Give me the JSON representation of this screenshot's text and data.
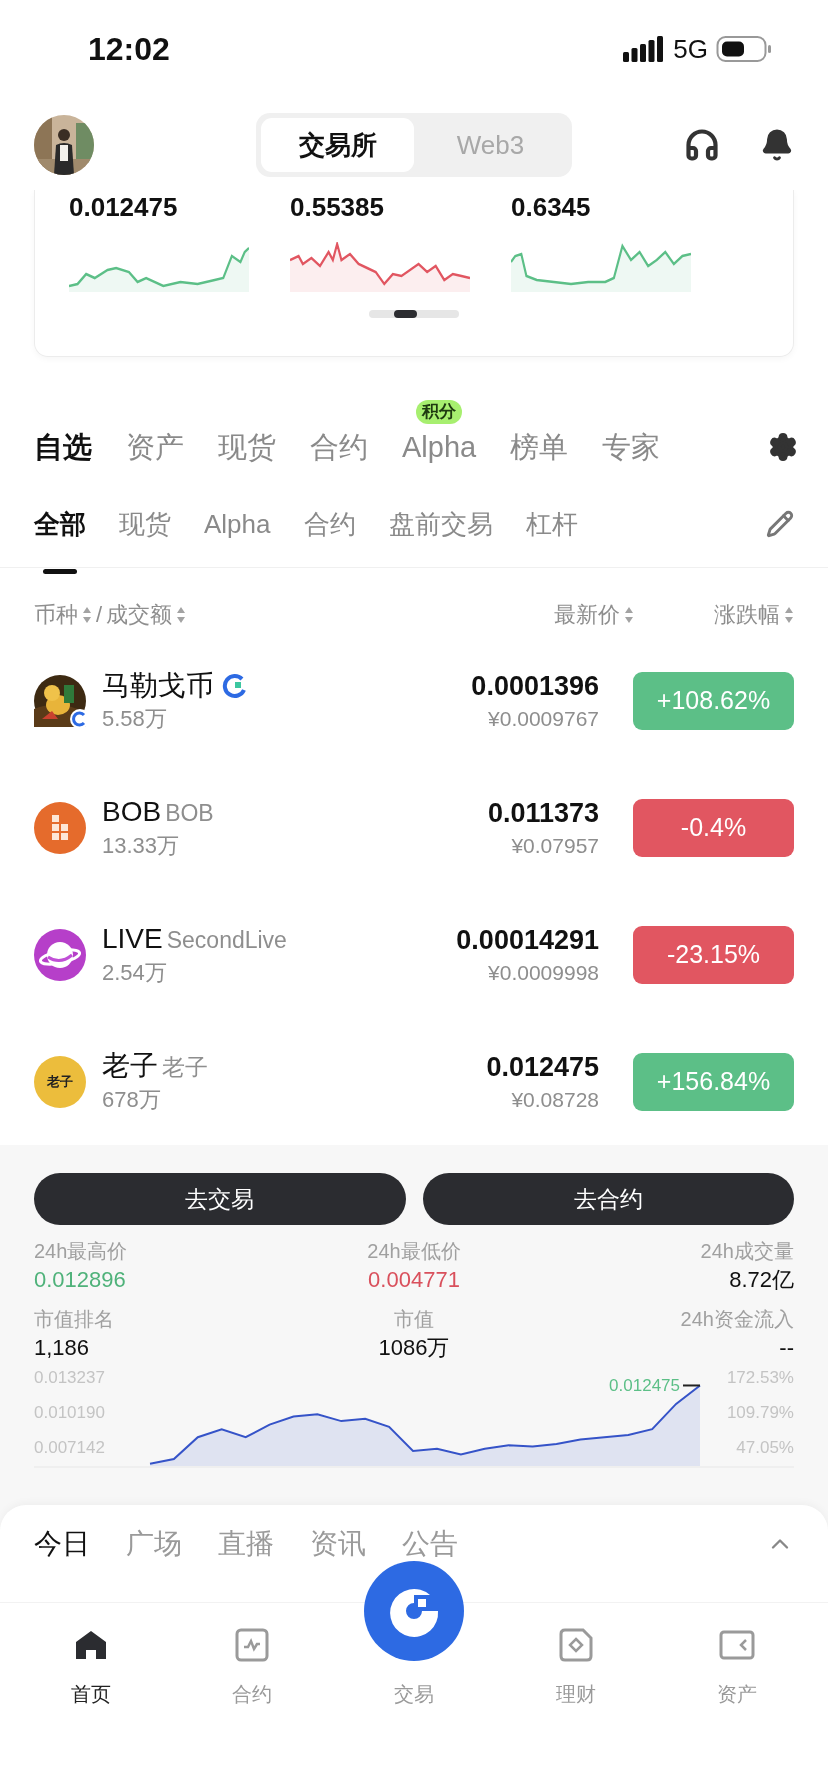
{
  "status_bar": {
    "time": "12:02",
    "network": "5G"
  },
  "header": {
    "segments": [
      {
        "label": "交易所",
        "selected": true
      },
      {
        "label": "Web3",
        "selected": false
      }
    ]
  },
  "tickers": [
    {
      "price": "0.012475",
      "color": "#5cbf87"
    },
    {
      "price": "0.55385",
      "color": "#e15661"
    },
    {
      "price": "0.6345",
      "color": "#5cbf87"
    }
  ],
  "market_tabs": [
    {
      "label": "自选",
      "selected": true
    },
    {
      "label": "资产",
      "selected": false
    },
    {
      "label": "现货",
      "selected": false
    },
    {
      "label": "合约",
      "selected": false
    },
    {
      "label": "Alpha",
      "selected": false,
      "badge": "积分"
    },
    {
      "label": "榜单",
      "selected": false
    },
    {
      "label": "专家",
      "selected": false
    }
  ],
  "filter_tabs": [
    {
      "label": "全部",
      "selected": true
    },
    {
      "label": "现货",
      "selected": false
    },
    {
      "label": "Alpha",
      "selected": false
    },
    {
      "label": "合约",
      "selected": false
    },
    {
      "label": "盘前交易",
      "selected": false
    },
    {
      "label": "杠杆",
      "selected": false
    }
  ],
  "column_headers": {
    "left": [
      {
        "kind": "sort",
        "label": "币种"
      },
      {
        "kind": "text",
        "label": "/"
      },
      {
        "kind": "sort",
        "label": "成交额"
      }
    ],
    "right": [
      {
        "kind": "sort",
        "label": "最新价"
      },
      {
        "kind": "sort",
        "label": "涨跌幅"
      }
    ]
  },
  "coins": [
    {
      "kind": "picture",
      "name": "马勒戈币",
      "verified": true,
      "volume": "5.58万",
      "price": "0.0001396",
      "price_cny": "¥0.0009767",
      "change": "+108.62%",
      "color": "#5cbf87"
    },
    {
      "kind": "grid",
      "name": "BOB",
      "full_name": "BOB",
      "verified": false,
      "volume": "13.33万",
      "price": "0.011373",
      "price_cny": "¥0.07957",
      "change": "-0.4%",
      "color": "#e15661"
    },
    {
      "kind": "planet",
      "name": "LIVE",
      "full_name": "SecondLive",
      "verified": false,
      "volume": "2.54万",
      "price": "0.00014291",
      "price_cny": "¥0.0009998",
      "change": "-23.15%",
      "color": "#e15661"
    },
    {
      "kind": "text",
      "logo_text": "老子",
      "name": "老子",
      "full_name": "老子",
      "verified": false,
      "volume": "678万",
      "price": "0.012475",
      "price_cny": "¥0.08728",
      "change": "+156.84%",
      "color": "#5cbf87"
    }
  ],
  "detail": {
    "actions": [
      {
        "label": "去交易"
      },
      {
        "label": "去合约"
      }
    ],
    "stats": [
      {
        "label": "24h最高价",
        "value": "0.012896",
        "color": "#4fb27a"
      },
      {
        "label": "24h最低价",
        "value": "0.004771",
        "color": "#d9505c"
      },
      {
        "label": "24h成交量",
        "value": "8.72亿",
        "color": "#111111"
      },
      {
        "label": "市值排名",
        "value": "1,186",
        "color": "#111111"
      },
      {
        "label": "市值",
        "value": "1086万",
        "color": "#111111"
      },
      {
        "label": "24h资金流入",
        "value": "--",
        "color": "#111111"
      }
    ],
    "chart": {
      "right_ticks": [
        "172.53%",
        "109.79%",
        "47.05%"
      ],
      "chart_data": {
        "type": "area",
        "ylim": [
          0.0055,
          0.013237
        ],
        "yticks": [
          {
            "value": 0.013237,
            "label": "0.013237"
          },
          {
            "value": 0.01019,
            "label": "0.010190"
          },
          {
            "value": 0.007142,
            "label": "0.007142"
          }
        ],
        "series": [
          {
            "color": "#3553c8",
            "values": [
              0.0057,
              0.0061,
              0.008,
              0.0087,
              0.008,
              0.0091,
              0.0098,
              0.01,
              0.0094,
              0.0096,
              0.0089,
              0.0068,
              0.007,
              0.0065,
              0.007,
              0.0073,
              0.0072,
              0.0074,
              0.0078,
              0.008,
              0.0082,
              0.0087,
              0.0109,
              0.0125
            ]
          }
        ],
        "annotations": [
          {
            "text": "0.012475"
          }
        ]
      }
    }
  },
  "sheet_tabs": [
    {
      "label": "今日",
      "selected": true
    },
    {
      "label": "广场",
      "selected": false
    },
    {
      "label": "直播",
      "selected": false
    },
    {
      "label": "资讯",
      "selected": false
    },
    {
      "label": "公告",
      "selected": false
    }
  ],
  "nav": [
    {
      "kind": "home",
      "label": "首页",
      "selected": true
    },
    {
      "kind": "futures",
      "label": "合约",
      "selected": false
    },
    {
      "kind": "trade",
      "label": "交易",
      "selected": false
    },
    {
      "kind": "earn",
      "label": "理财",
      "selected": false
    },
    {
      "kind": "assets",
      "label": "资产",
      "selected": false
    }
  ]
}
